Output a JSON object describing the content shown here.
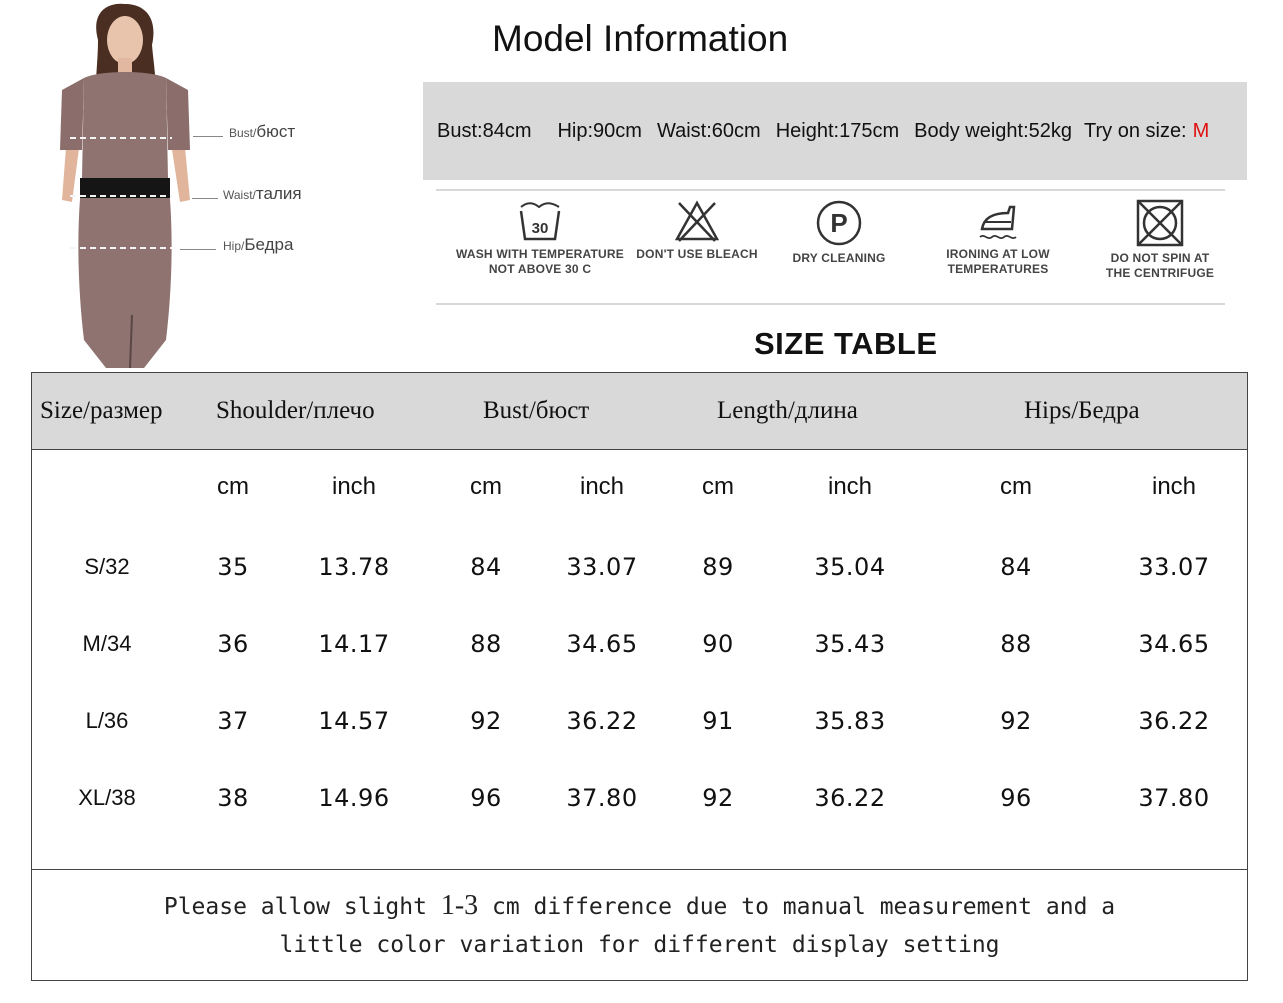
{
  "model_figure": {
    "labels": [
      {
        "en": "Bust/",
        "ru": "бюст"
      },
      {
        "en": "Waist/",
        "ru": "талия"
      },
      {
        "en": "Hip/",
        "ru": "Бедра"
      }
    ]
  },
  "model_info": {
    "title": "Model Information",
    "bust": "Bust:84cm",
    "hip": "Hip:90cm",
    "waist": "Waist:60cm",
    "height": "Height:175cm",
    "weight": "Body weight:52kg",
    "try_on_label": "Try on size:",
    "try_on_value": "M",
    "accent_color": "#e01010"
  },
  "care": [
    {
      "icon": "wash-30-icon",
      "line1": "WASH WITH TEMPERATURE",
      "line2": "NOT ABOVE 30 C",
      "badge": "30"
    },
    {
      "icon": "no-bleach-icon",
      "line1": "DON'T USE BLEACH",
      "line2": ""
    },
    {
      "icon": "dry-clean-icon",
      "line1": "DRY CLEANING",
      "line2": "",
      "badge": "P"
    },
    {
      "icon": "iron-low-icon",
      "line1": "IRONING AT LOW",
      "line2": "TEMPERATURES"
    },
    {
      "icon": "no-spin-icon",
      "line1": "DO NOT SPIN AT",
      "line2": "THE CENTRIFUGE"
    }
  ],
  "size_table": {
    "title": "SIZE TABLE",
    "headers": [
      "Size/размер",
      "Shoulder/плечо",
      "Bust/бюст",
      "Length/длина",
      "Hips/Бедра"
    ],
    "units": [
      "cm",
      "inch",
      "cm",
      "inch",
      "cm",
      "inch",
      "cm",
      "inch"
    ],
    "rows": [
      {
        "size": "S/32",
        "values": [
          "35",
          "13.78",
          "84",
          "33.07",
          "89",
          "35.04",
          "84",
          "33.07"
        ]
      },
      {
        "size": "M/34",
        "values": [
          "36",
          "14.17",
          "88",
          "34.65",
          "90",
          "35.43",
          "88",
          "34.65"
        ]
      },
      {
        "size": "L/36",
        "values": [
          "37",
          "14.57",
          "92",
          "36.22",
          "91",
          "35.83",
          "92",
          "36.22"
        ]
      },
      {
        "size": "XL/38",
        "values": [
          "38",
          "14.96",
          "96",
          "37.80",
          "92",
          "36.22",
          "96",
          "37.80"
        ]
      }
    ],
    "note_before": "Please allow slight ",
    "note_range": "1-3",
    "note_after": " cm difference due to manual measurement and a",
    "note_line2": "little color variation for different display setting"
  }
}
